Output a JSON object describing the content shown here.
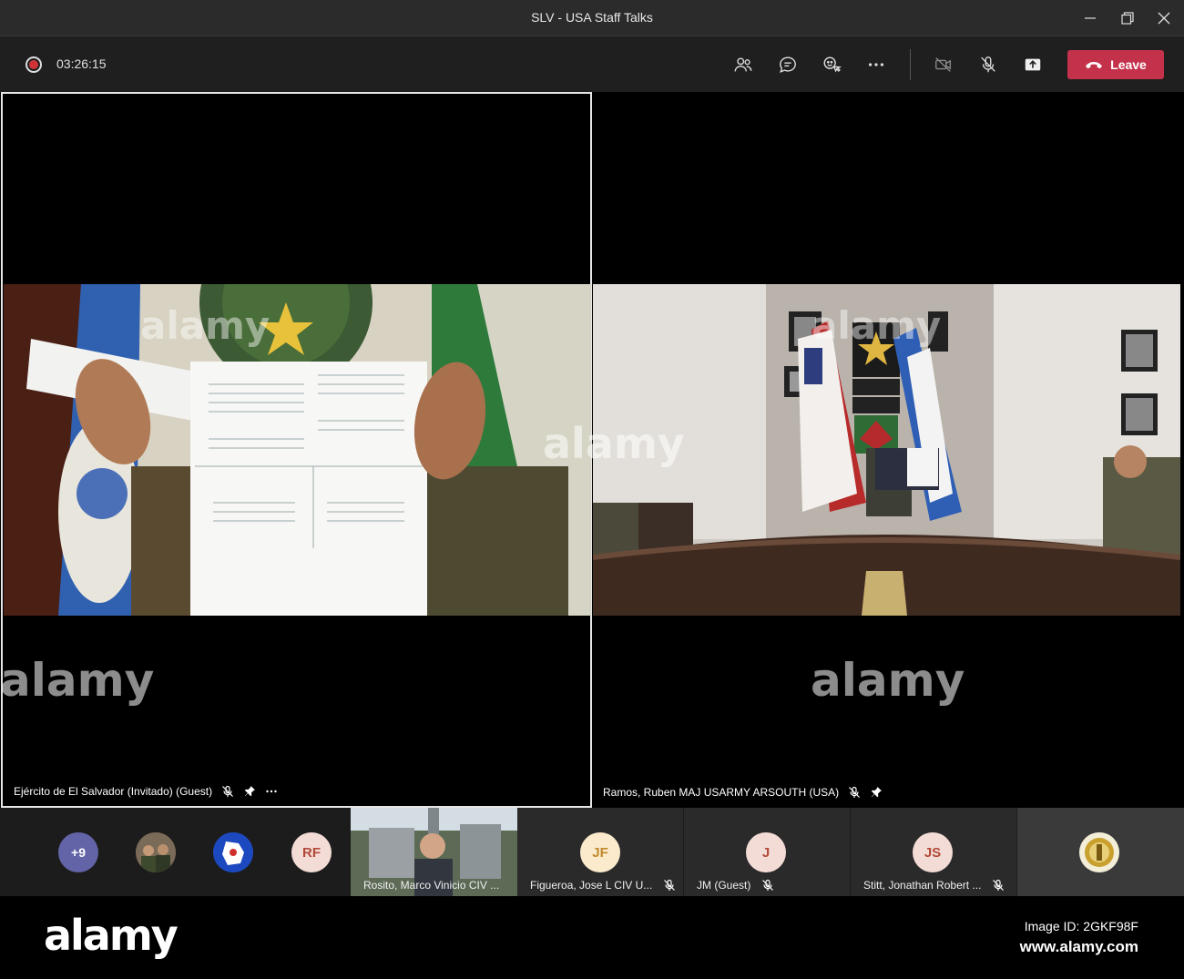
{
  "window": {
    "title": "SLV - USA Staff Talks"
  },
  "toolbar": {
    "timer": "03:26:15",
    "leave_label": "Leave"
  },
  "tiles": [
    {
      "name": "Ejército de El Salvador (Invitado) (Guest)"
    },
    {
      "name": "Ramos, Ruben MAJ USARMY ARSOUTH (USA)"
    }
  ],
  "participants": {
    "overflow_count": "+9",
    "rf_initials": "RF",
    "rosito_name": "Rosito, Marco Vinicio CIV ...",
    "figueroa_initials": "JF",
    "figueroa_name": "Figueroa, Jose L CIV U...",
    "jm_initials": "J",
    "jm_name": "JM (Guest)",
    "stitt_initials": "JS",
    "stitt_name": "Stitt, Jonathan Robert ..."
  },
  "watermark": {
    "brand": "alamy",
    "image_id": "Image ID: 2GKF98F",
    "site": "www.alamy.com"
  },
  "colors": {
    "leave_button": "#c4314b",
    "recording": "#d13438",
    "avatar_overflow": "#6264a7",
    "avatar_initials_bg": "#f4dcd6"
  }
}
